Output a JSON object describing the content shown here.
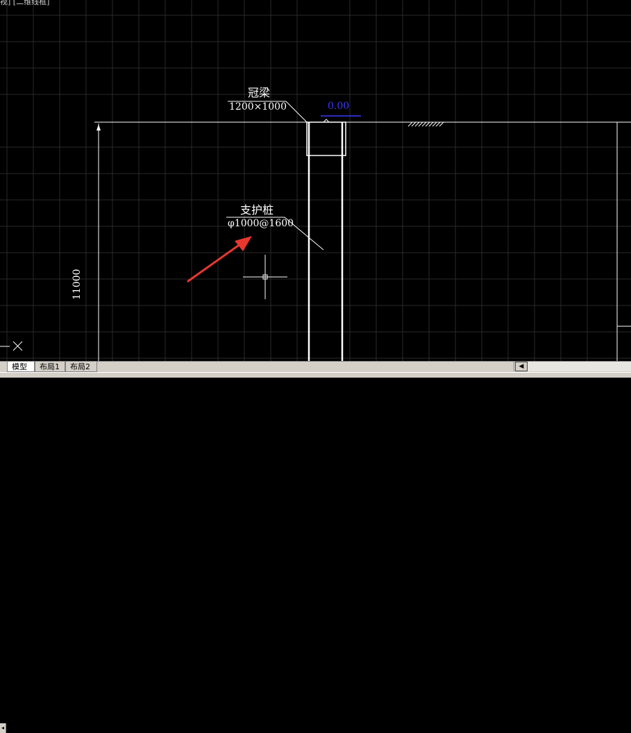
{
  "viewport": {
    "label": "视] [二维线框]"
  },
  "drawing": {
    "cap_beam": {
      "name": "冠梁",
      "size": "1200×1000"
    },
    "elevation": {
      "value": "0.00"
    },
    "pile": {
      "name": "支护桩",
      "spec": "φ1000@1600"
    },
    "dimension": {
      "value": "11000"
    }
  },
  "colors": {
    "background": "#000000",
    "grid": "#2a2a2a",
    "lines": "#ffffff",
    "elevation": "#3a3aff",
    "arrow": "#e8382e"
  },
  "tabs": [
    {
      "label": "模型",
      "active": true
    },
    {
      "label": "布局1",
      "active": false
    },
    {
      "label": "布局2",
      "active": false
    }
  ],
  "icons": {
    "ucs": "ucs-icon",
    "crosshair": "crosshair-cursor-icon",
    "scroll_left": "scroll-left-arrow-icon"
  }
}
